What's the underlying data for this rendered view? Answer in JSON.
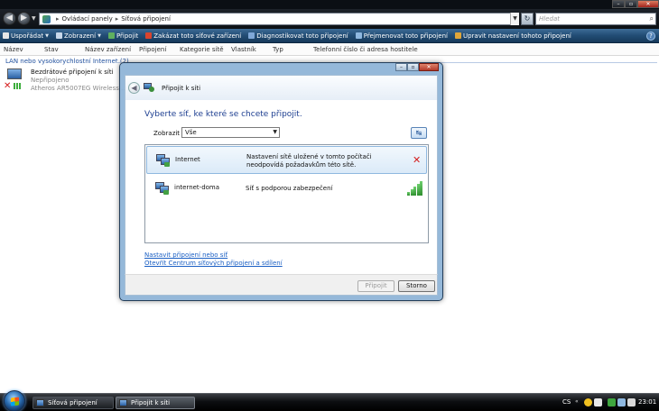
{
  "explorer": {
    "breadcrumb": [
      "Ovládací panely",
      "Síťová připojení"
    ],
    "breadcrumb_sep": "▸",
    "search_placeholder": "Hledat",
    "toolbar": [
      {
        "label": "Uspořádat",
        "has_dropdown": true,
        "icon_color": "#e6e6e6"
      },
      {
        "label": "Zobrazení",
        "has_dropdown": true,
        "icon_color": "#c8d8ea"
      },
      {
        "label": "Připojit",
        "has_dropdown": false,
        "icon_color": "#5fb05f"
      },
      {
        "label": "Zakázat toto síťové zařízení",
        "has_dropdown": false,
        "icon_color": "#d9442e"
      },
      {
        "label": "Diagnostikovat toto připojení",
        "has_dropdown": false,
        "icon_color": "#7fa8d8"
      },
      {
        "label": "Přejmenovat toto připojení",
        "has_dropdown": false,
        "icon_color": "#8fb8e0"
      },
      {
        "label": "Upravit nastavení tohoto připojení",
        "has_dropdown": false,
        "icon_color": "#e0a63a"
      }
    ],
    "help_label": "?",
    "columns": [
      "Název",
      "Stav",
      "Název zařízení",
      "Připojení",
      "Kategorie sítě",
      "Vlastník",
      "Typ",
      "Telefonní číslo či adresa hostitele"
    ],
    "group_header": "LAN nebo vysokorychlostní Internet (2)",
    "connection": {
      "name": "Bezdrátové připojení k síti",
      "status": "Nepřipojeno",
      "device": "Atheros AR5007EG Wireless ..."
    }
  },
  "dialog": {
    "title": "Připojit k síti",
    "heading": "Vyberte síť, ke které se chcete připojit.",
    "show_label": "Zobrazit",
    "show_value": "Vše",
    "networks": [
      {
        "name": "Internet",
        "description": "Nastavení sítě uložené v tomto počítači neodpovídá požadavkům této sítě.",
        "indicator": "error",
        "indicator_text": "✕",
        "selected": true
      },
      {
        "name": "internet-doma",
        "description": "Síť s podporou zabezpečení",
        "indicator": "signal",
        "signal_bars": 5,
        "selected": false
      }
    ],
    "links": [
      "Nastavit připojení nebo síť",
      "Otevřít Centrum síťových připojení a sdílení"
    ],
    "buttons": {
      "connect": "Připojit",
      "cancel": "Storno"
    },
    "connect_enabled": false
  },
  "taskbar": {
    "windows": [
      {
        "label": "Síťová připojení",
        "active": false
      },
      {
        "label": "Připojit k síti",
        "active": true
      }
    ],
    "language": "CS",
    "clock": "23:01"
  }
}
